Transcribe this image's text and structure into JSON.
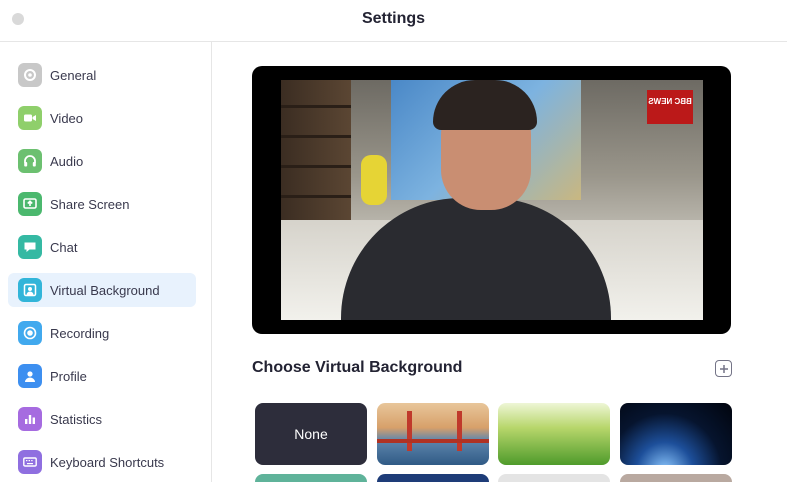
{
  "window": {
    "title": "Settings"
  },
  "sidebar": {
    "active_index": 5,
    "items": [
      {
        "label": "General",
        "icon": "gear-icon",
        "color": "#c8c8c8"
      },
      {
        "label": "Video",
        "icon": "video-camera-icon",
        "color": "#8fcf6b"
      },
      {
        "label": "Audio",
        "icon": "headphones-icon",
        "color": "#6cc070"
      },
      {
        "label": "Share Screen",
        "icon": "share-screen-icon",
        "color": "#4bb86e"
      },
      {
        "label": "Chat",
        "icon": "chat-bubble-icon",
        "color": "#35b9a3"
      },
      {
        "label": "Virtual Background",
        "icon": "person-frame-icon",
        "color": "#32b5d9"
      },
      {
        "label": "Recording",
        "icon": "record-icon",
        "color": "#41a9ee"
      },
      {
        "label": "Profile",
        "icon": "profile-icon",
        "color": "#3d8ff0"
      },
      {
        "label": "Statistics",
        "icon": "bar-chart-icon",
        "color": "#a66be0"
      },
      {
        "label": "Keyboard Shortcuts",
        "icon": "keyboard-icon",
        "color": "#8f6fe0"
      }
    ]
  },
  "preview": {
    "badge_text": "BBC NEWS"
  },
  "backgrounds": {
    "title": "Choose Virtual Background",
    "add_icon": "plus-icon",
    "items": [
      {
        "label": "None"
      },
      {
        "label": ""
      },
      {
        "label": ""
      },
      {
        "label": ""
      }
    ]
  },
  "colors": {
    "accent": "#0e72ed",
    "active_bg": "#e8f2fd",
    "text": "#232333"
  }
}
